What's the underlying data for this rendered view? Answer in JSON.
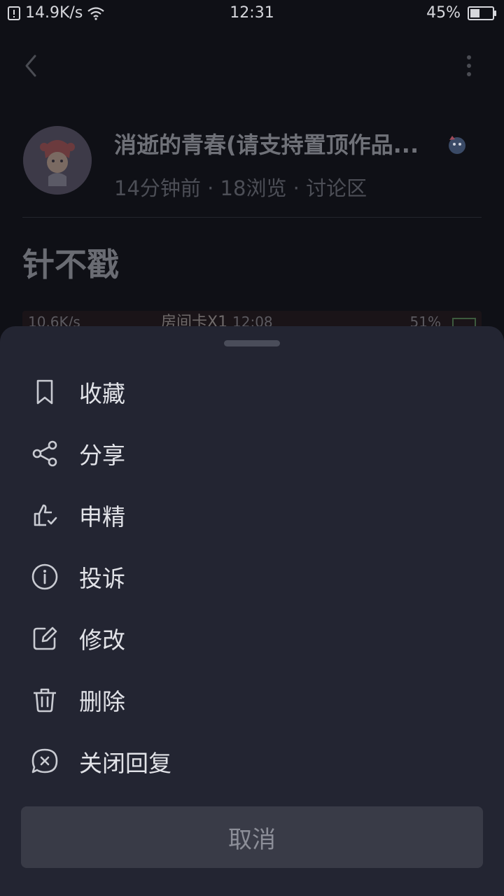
{
  "status_bar": {
    "network_speed": "14.9K/s",
    "time": "12:31",
    "battery": "45%"
  },
  "post": {
    "author_name": "消逝的青春(请支持置顶作品...",
    "meta": "14分钟前 · 18浏览 · 讨论区",
    "title": "针不戳",
    "embedded_screenshot": {
      "network_speed": "10.6K/s",
      "overlay_text": "房间卡X1",
      "time": "12:08",
      "battery": "51%"
    }
  },
  "sheet": {
    "items": [
      {
        "label": "收藏",
        "icon": "bookmark-icon"
      },
      {
        "label": "分享",
        "icon": "share-icon"
      },
      {
        "label": "申精",
        "icon": "thumbs-up-check-icon"
      },
      {
        "label": "投诉",
        "icon": "info-icon"
      },
      {
        "label": "修改",
        "icon": "edit-icon"
      },
      {
        "label": "删除",
        "icon": "trash-icon"
      },
      {
        "label": "关闭回复",
        "icon": "close-reply-icon"
      }
    ],
    "cancel_label": "取消"
  }
}
